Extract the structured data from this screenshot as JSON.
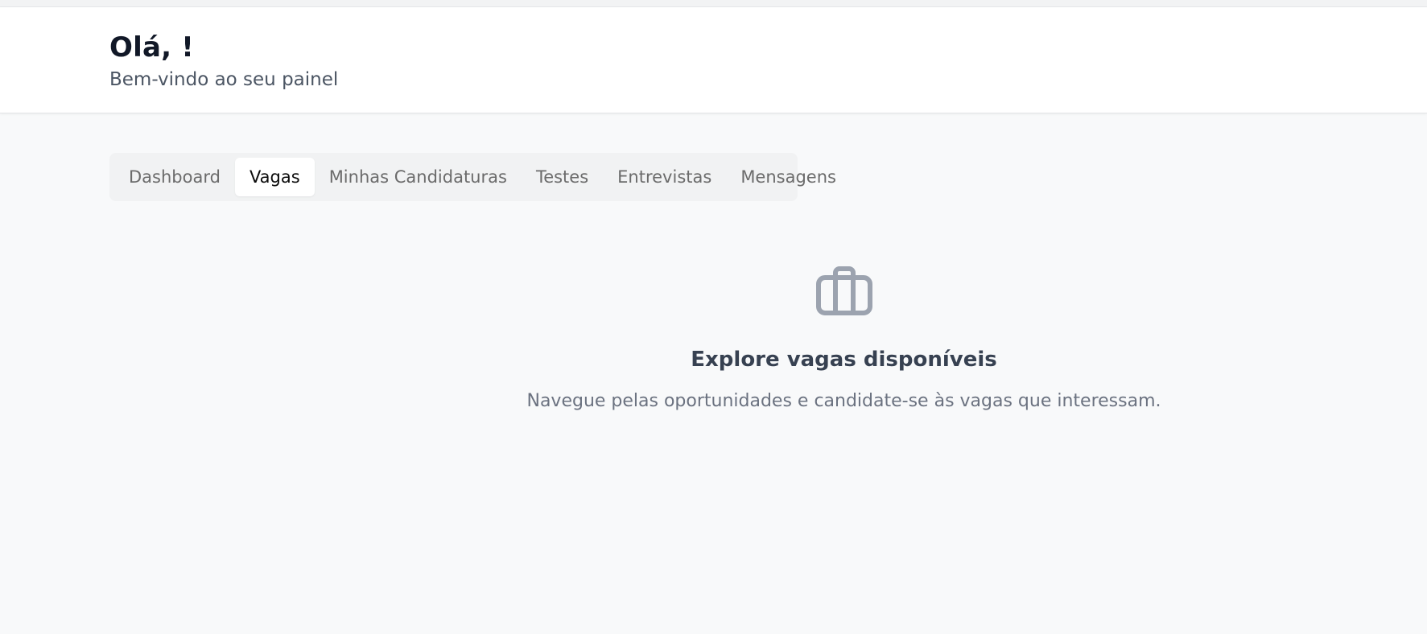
{
  "header": {
    "greeting": "Olá, !",
    "subtitle": "Bem-vindo ao seu painel"
  },
  "tabs": [
    {
      "label": "Dashboard",
      "active": false
    },
    {
      "label": "Vagas",
      "active": true
    },
    {
      "label": "Minhas Candidaturas",
      "active": false
    },
    {
      "label": "Testes",
      "active": false
    },
    {
      "label": "Entrevistas",
      "active": false
    },
    {
      "label": "Mensagens",
      "active": false
    }
  ],
  "empty_state": {
    "icon": "briefcase-icon",
    "title": "Explore vagas disponíveis",
    "description": "Navegue pelas oportunidades e candidate-se às vagas que interessam."
  },
  "colors": {
    "background": "#f8f9fa",
    "header_bg": "#ffffff",
    "icon": "#9ca3af",
    "title": "#111827"
  }
}
